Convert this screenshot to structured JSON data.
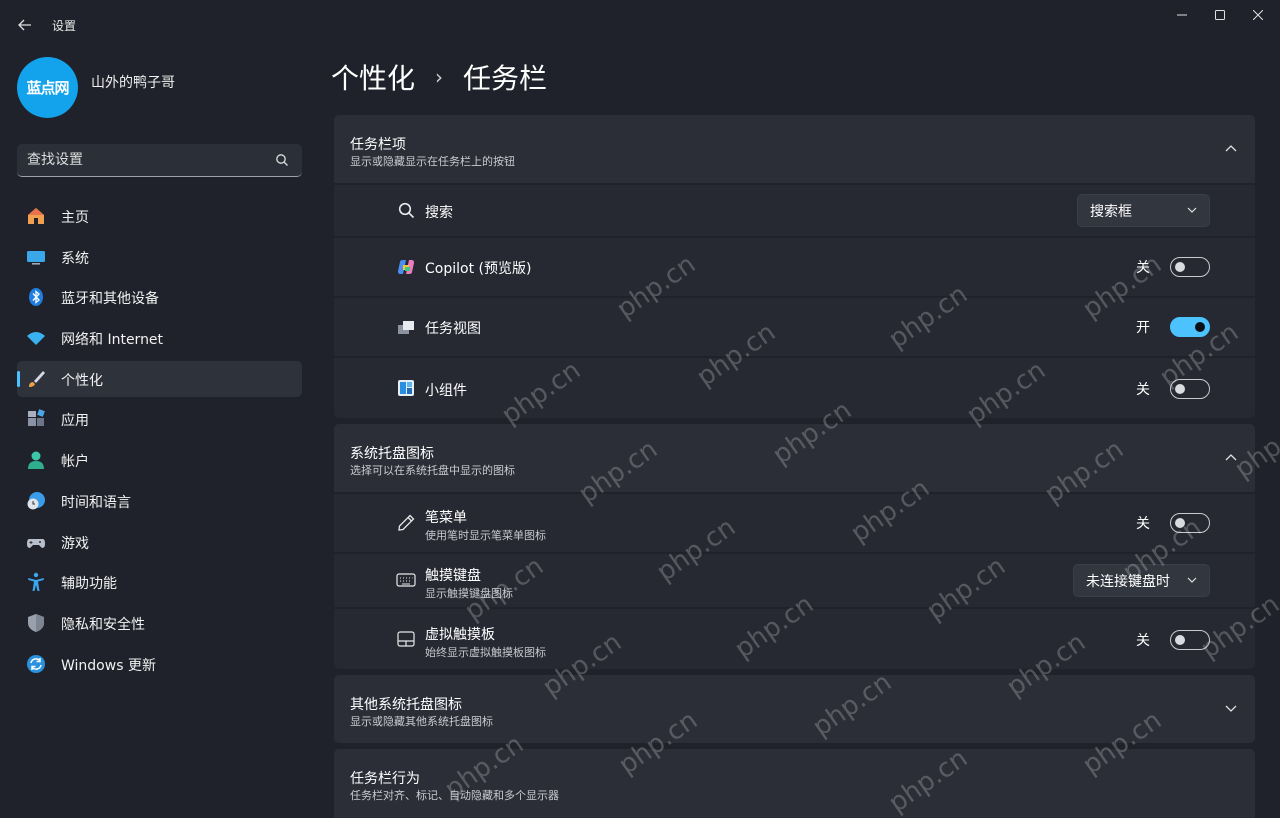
{
  "window": {
    "title": "设置",
    "controls": [
      "minimize-icon",
      "maximize-icon",
      "close-icon"
    ]
  },
  "profile": {
    "avatar_text": "蓝点网",
    "name": "山外的鸭子哥"
  },
  "search": {
    "placeholder": "查找设置",
    "value": ""
  },
  "nav": {
    "items": [
      {
        "label": "主页",
        "icon": "home-icon"
      },
      {
        "label": "系统",
        "icon": "system-monitor-icon"
      },
      {
        "label": "蓝牙和其他设备",
        "icon": "bluetooth-icon"
      },
      {
        "label": "网络和 Internet",
        "icon": "wifi-icon"
      },
      {
        "label": "个性化",
        "icon": "brush-icon",
        "active": true
      },
      {
        "label": "应用",
        "icon": "apps-icon"
      },
      {
        "label": "帐户",
        "icon": "account-icon"
      },
      {
        "label": "时间和语言",
        "icon": "time-language-icon"
      },
      {
        "label": "游戏",
        "icon": "gamepad-icon"
      },
      {
        "label": "辅助功能",
        "icon": "accessibility-icon"
      },
      {
        "label": "隐私和安全性",
        "icon": "shield-icon"
      },
      {
        "label": "Windows 更新",
        "icon": "windows-update-icon"
      }
    ]
  },
  "breadcrumb": {
    "parent": "个性化",
    "separator": "›",
    "current": "任务栏"
  },
  "sections": {
    "taskbar_items": {
      "title": "任务栏项",
      "subtitle": "显示或隐藏显示在任务栏上的按钮",
      "rows": {
        "search": {
          "label": "搜索",
          "dropdown_value": "搜索框"
        },
        "copilot": {
          "label": "Copilot (预览版)",
          "state_label": "关",
          "on": false
        },
        "task_view": {
          "label": "任务视图",
          "state_label": "开",
          "on": true
        },
        "widgets": {
          "label": "小组件",
          "state_label": "关",
          "on": false
        }
      }
    },
    "tray_icons": {
      "title": "系统托盘图标",
      "subtitle": "选择可以在系统托盘中显示的图标",
      "rows": {
        "pen_menu": {
          "label": "笔菜单",
          "sub": "使用笔时显示笔菜单图标",
          "state_label": "关",
          "on": false
        },
        "touch_keyboard": {
          "label": "触摸键盘",
          "sub": "显示触摸键盘图标",
          "dropdown_value": "未连接键盘时"
        },
        "virtual_touchpad": {
          "label": "虚拟触摸板",
          "sub": "始终显示虚拟触摸板图标",
          "state_label": "关",
          "on": false
        }
      }
    },
    "other_tray": {
      "title": "其他系统托盘图标",
      "subtitle": "显示或隐藏其他系统托盘图标"
    },
    "behaviors": {
      "title": "任务栏行为",
      "subtitle": "任务栏对齐、标记、自动隐藏和多个显示器"
    }
  },
  "watermark": "php.cn",
  "colors": {
    "accent": "#4cc2ff",
    "background": "#1f222a",
    "card": "#262932",
    "card_header": "#2b2e37"
  }
}
